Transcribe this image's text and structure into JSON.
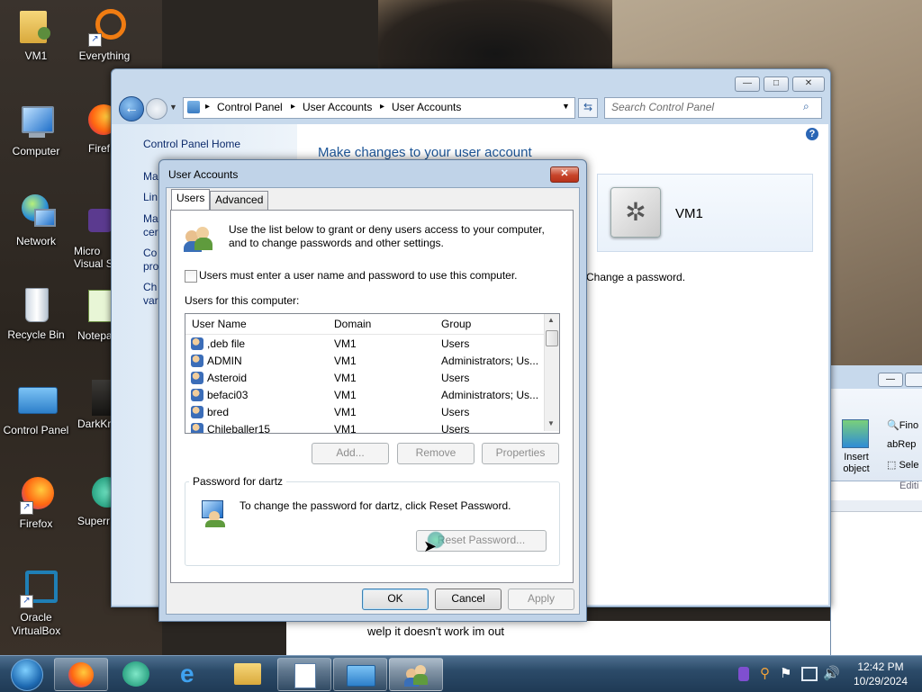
{
  "desktop": {
    "icons": [
      {
        "label": "VM1"
      },
      {
        "label": "Everything"
      },
      {
        "label": "Computer"
      },
      {
        "label": "Firef"
      },
      {
        "label": "Network"
      },
      {
        "label": "Micro Visual S"
      },
      {
        "label": "Recycle Bin"
      },
      {
        "label": "Notepa"
      },
      {
        "label": "Control Panel"
      },
      {
        "label": "DarkKr"
      },
      {
        "label": "Firefox"
      },
      {
        "label": "Superr"
      },
      {
        "label": "Oracle VirtualBox"
      }
    ],
    "caption": "welp it doesn't work im out"
  },
  "control_panel": {
    "breadcrumb": [
      "Control Panel",
      "User Accounts",
      "User Accounts"
    ],
    "search_placeholder": "Search Control Panel",
    "home_link": "Control Panel Home",
    "left_links": [
      "Ma",
      "Lin",
      "Ma cer",
      "Co pro",
      "Ch var"
    ],
    "heading": "Make changes to your user account",
    "account_name": "VM1",
    "change_password": "Change a password."
  },
  "word_window": {
    "insert_object": "Insert object",
    "find": "Fino",
    "replace": "Rep",
    "select": "Sele",
    "editing": "Editi"
  },
  "dialog": {
    "title": "User Accounts",
    "tabs": [
      "Users",
      "Advanced"
    ],
    "intro": "Use the list below to grant or deny users access to your computer, and to change passwords and other settings.",
    "checkbox_label": "Users must enter a user name and password to use this computer.",
    "checkbox_checked": false,
    "users_label": "Users for this computer:",
    "columns": [
      "User Name",
      "Domain",
      "Group"
    ],
    "users": [
      {
        "name": ",deb file",
        "domain": "VM1",
        "group": "Users"
      },
      {
        "name": "ADMIN",
        "domain": "VM1",
        "group": "Administrators; Us..."
      },
      {
        "name": "Asteroid",
        "domain": "VM1",
        "group": "Users"
      },
      {
        "name": "befaci03",
        "domain": "VM1",
        "group": "Administrators; Us..."
      },
      {
        "name": "bred",
        "domain": "VM1",
        "group": "Users"
      },
      {
        "name": "Chileballer15",
        "domain": "VM1",
        "group": "Users"
      }
    ],
    "buttons": {
      "add": "Add...",
      "remove": "Remove",
      "properties": "Properties"
    },
    "password_group_title": "Password for dartz",
    "password_text": "To change the password for dartz, click Reset Password.",
    "reset_password": "Reset Password...",
    "ok": "OK",
    "cancel": "Cancel",
    "apply": "Apply"
  },
  "taskbar": {
    "time": "12:42 PM",
    "date": "10/29/2024"
  },
  "colors": {
    "link_blue": "#1e3f8f",
    "heading_blue": "#1e5799",
    "taskbar": "#2c4b69"
  }
}
